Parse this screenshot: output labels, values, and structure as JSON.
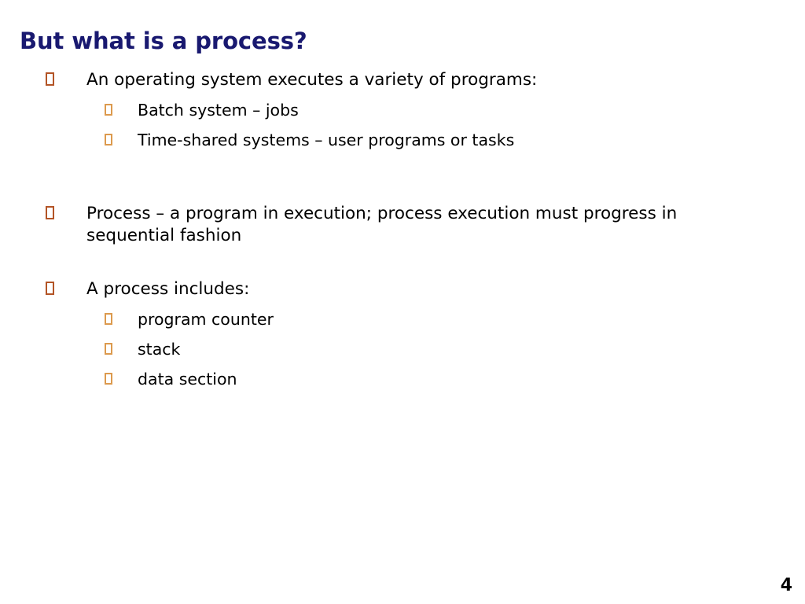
{
  "slide": {
    "title": "But what is a process?",
    "page_number": "4",
    "title_color": "#191970",
    "level1_bullet_color": "#b35426",
    "level2_bullet_color": "#dc9a4e",
    "background_color": "#ffffff",
    "text_color": "#000000"
  },
  "content": [
    {
      "level": 1,
      "text": "An operating system executes a variety of programs:"
    },
    {
      "level": 2,
      "text": "Batch system – jobs"
    },
    {
      "level": 2,
      "text": "Time-shared systems – user programs or tasks"
    },
    {
      "level": 1,
      "text": "Process – a program in execution; process execution must progress in sequential fashion"
    },
    {
      "level": 1,
      "text": "A process includes:"
    },
    {
      "level": 2,
      "text": "program counter"
    },
    {
      "level": 2,
      "text": "stack"
    },
    {
      "level": 2,
      "text": "data section"
    }
  ]
}
